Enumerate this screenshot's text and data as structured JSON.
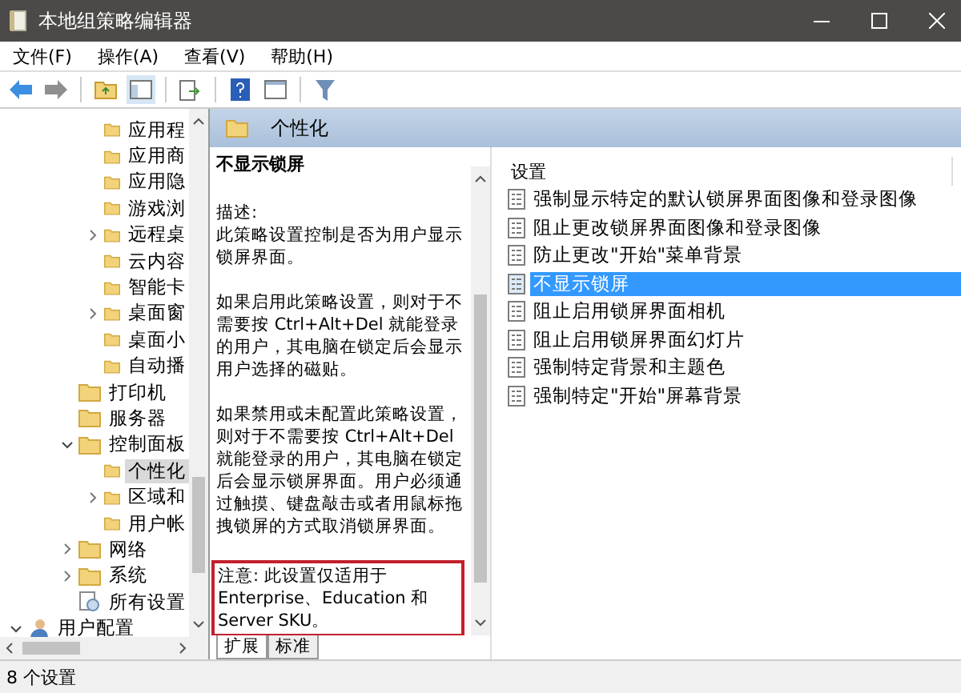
{
  "window": {
    "title": "本地组策略编辑器"
  },
  "menu": [
    "文件(F)",
    "操作(A)",
    "查看(V)",
    "帮助(H)"
  ],
  "tree": {
    "inner_items": [
      {
        "label": "应用程",
        "kind": "folder",
        "selected": false
      },
      {
        "label": "应用商",
        "kind": "folder",
        "selected": false
      },
      {
        "label": "应用隐",
        "kind": "folder",
        "selected": false
      },
      {
        "label": "游戏浏",
        "kind": "folder",
        "selected": false
      },
      {
        "label": "远程桌",
        "kind": "folder",
        "expanded": false,
        "selected": false
      },
      {
        "label": "云内容",
        "kind": "folder",
        "selected": false
      },
      {
        "label": "智能卡",
        "kind": "folder",
        "selected": false
      },
      {
        "label": "桌面窗",
        "kind": "folder",
        "expanded": false,
        "selected": false
      },
      {
        "label": "桌面小",
        "kind": "folder",
        "selected": false
      },
      {
        "label": "自动播",
        "kind": "folder",
        "selected": false
      }
    ],
    "items": [
      {
        "label": "打印机",
        "kind": "folder",
        "selected": false
      },
      {
        "label": "服务器",
        "kind": "folder",
        "selected": false
      },
      {
        "label": "控制面板",
        "kind": "folder",
        "expanded": true,
        "selected": false,
        "children": [
          {
            "label": "个性化",
            "kind": "folder",
            "selected": true
          },
          {
            "label": "区域和",
            "kind": "folder",
            "expanded": false,
            "selected": false
          },
          {
            "label": "用户帐",
            "kind": "folder",
            "selected": false
          }
        ]
      },
      {
        "label": "网络",
        "kind": "folder",
        "expanded": false,
        "selected": false
      },
      {
        "label": "系统",
        "kind": "folder",
        "expanded": false,
        "selected": false
      },
      {
        "label": "所有设置",
        "kind": "settings",
        "selected": false
      }
    ],
    "root_items": [
      {
        "label": "用户配置",
        "kind": "user",
        "expanded": true,
        "selected": false
      }
    ]
  },
  "header": {
    "title": "个性化"
  },
  "description": {
    "title": "不显示锁屏",
    "paragraphs": [
      "描述:\n此策略设置控制是否为用户显示锁屏界面。",
      "如果启用此策略设置，则对于不需要按 Ctrl+Alt+Del 就能登录的用户，其电脑在锁定后会显示用户选择的磁贴。",
      "如果禁用或未配置此策略设置，则对于不需要按 Ctrl+Alt+Del 就能登录的用户，其电脑在锁定后会显示锁屏界面。用户必须通过触摸、键盘敲击或者用鼠标拖拽锁屏的方式取消锁屏界面。"
    ],
    "note": "注意: 此设置仅适用于 Enterprise、Education 和 Server SKU。"
  },
  "view_tabs": [
    {
      "label": "扩展",
      "selected": true
    },
    {
      "label": "标准",
      "selected": false
    }
  ],
  "settings": {
    "column": "设置",
    "rows": [
      {
        "label": "强制显示特定的默认锁屏界面图像和登录图像",
        "selected": false
      },
      {
        "label": "阻止更改锁屏界面图像和登录图像",
        "selected": false
      },
      {
        "label": "防止更改\"开始\"菜单背景",
        "selected": false
      },
      {
        "label": "不显示锁屏",
        "selected": true
      },
      {
        "label": "阻止启用锁屏界面相机",
        "selected": false
      },
      {
        "label": "阻止启用锁屏界面幻灯片",
        "selected": false
      },
      {
        "label": "强制特定背景和主题色",
        "selected": false
      },
      {
        "label": "强制特定\"开始\"屏幕背景",
        "selected": false
      }
    ]
  },
  "status_bar": "8 个设置"
}
